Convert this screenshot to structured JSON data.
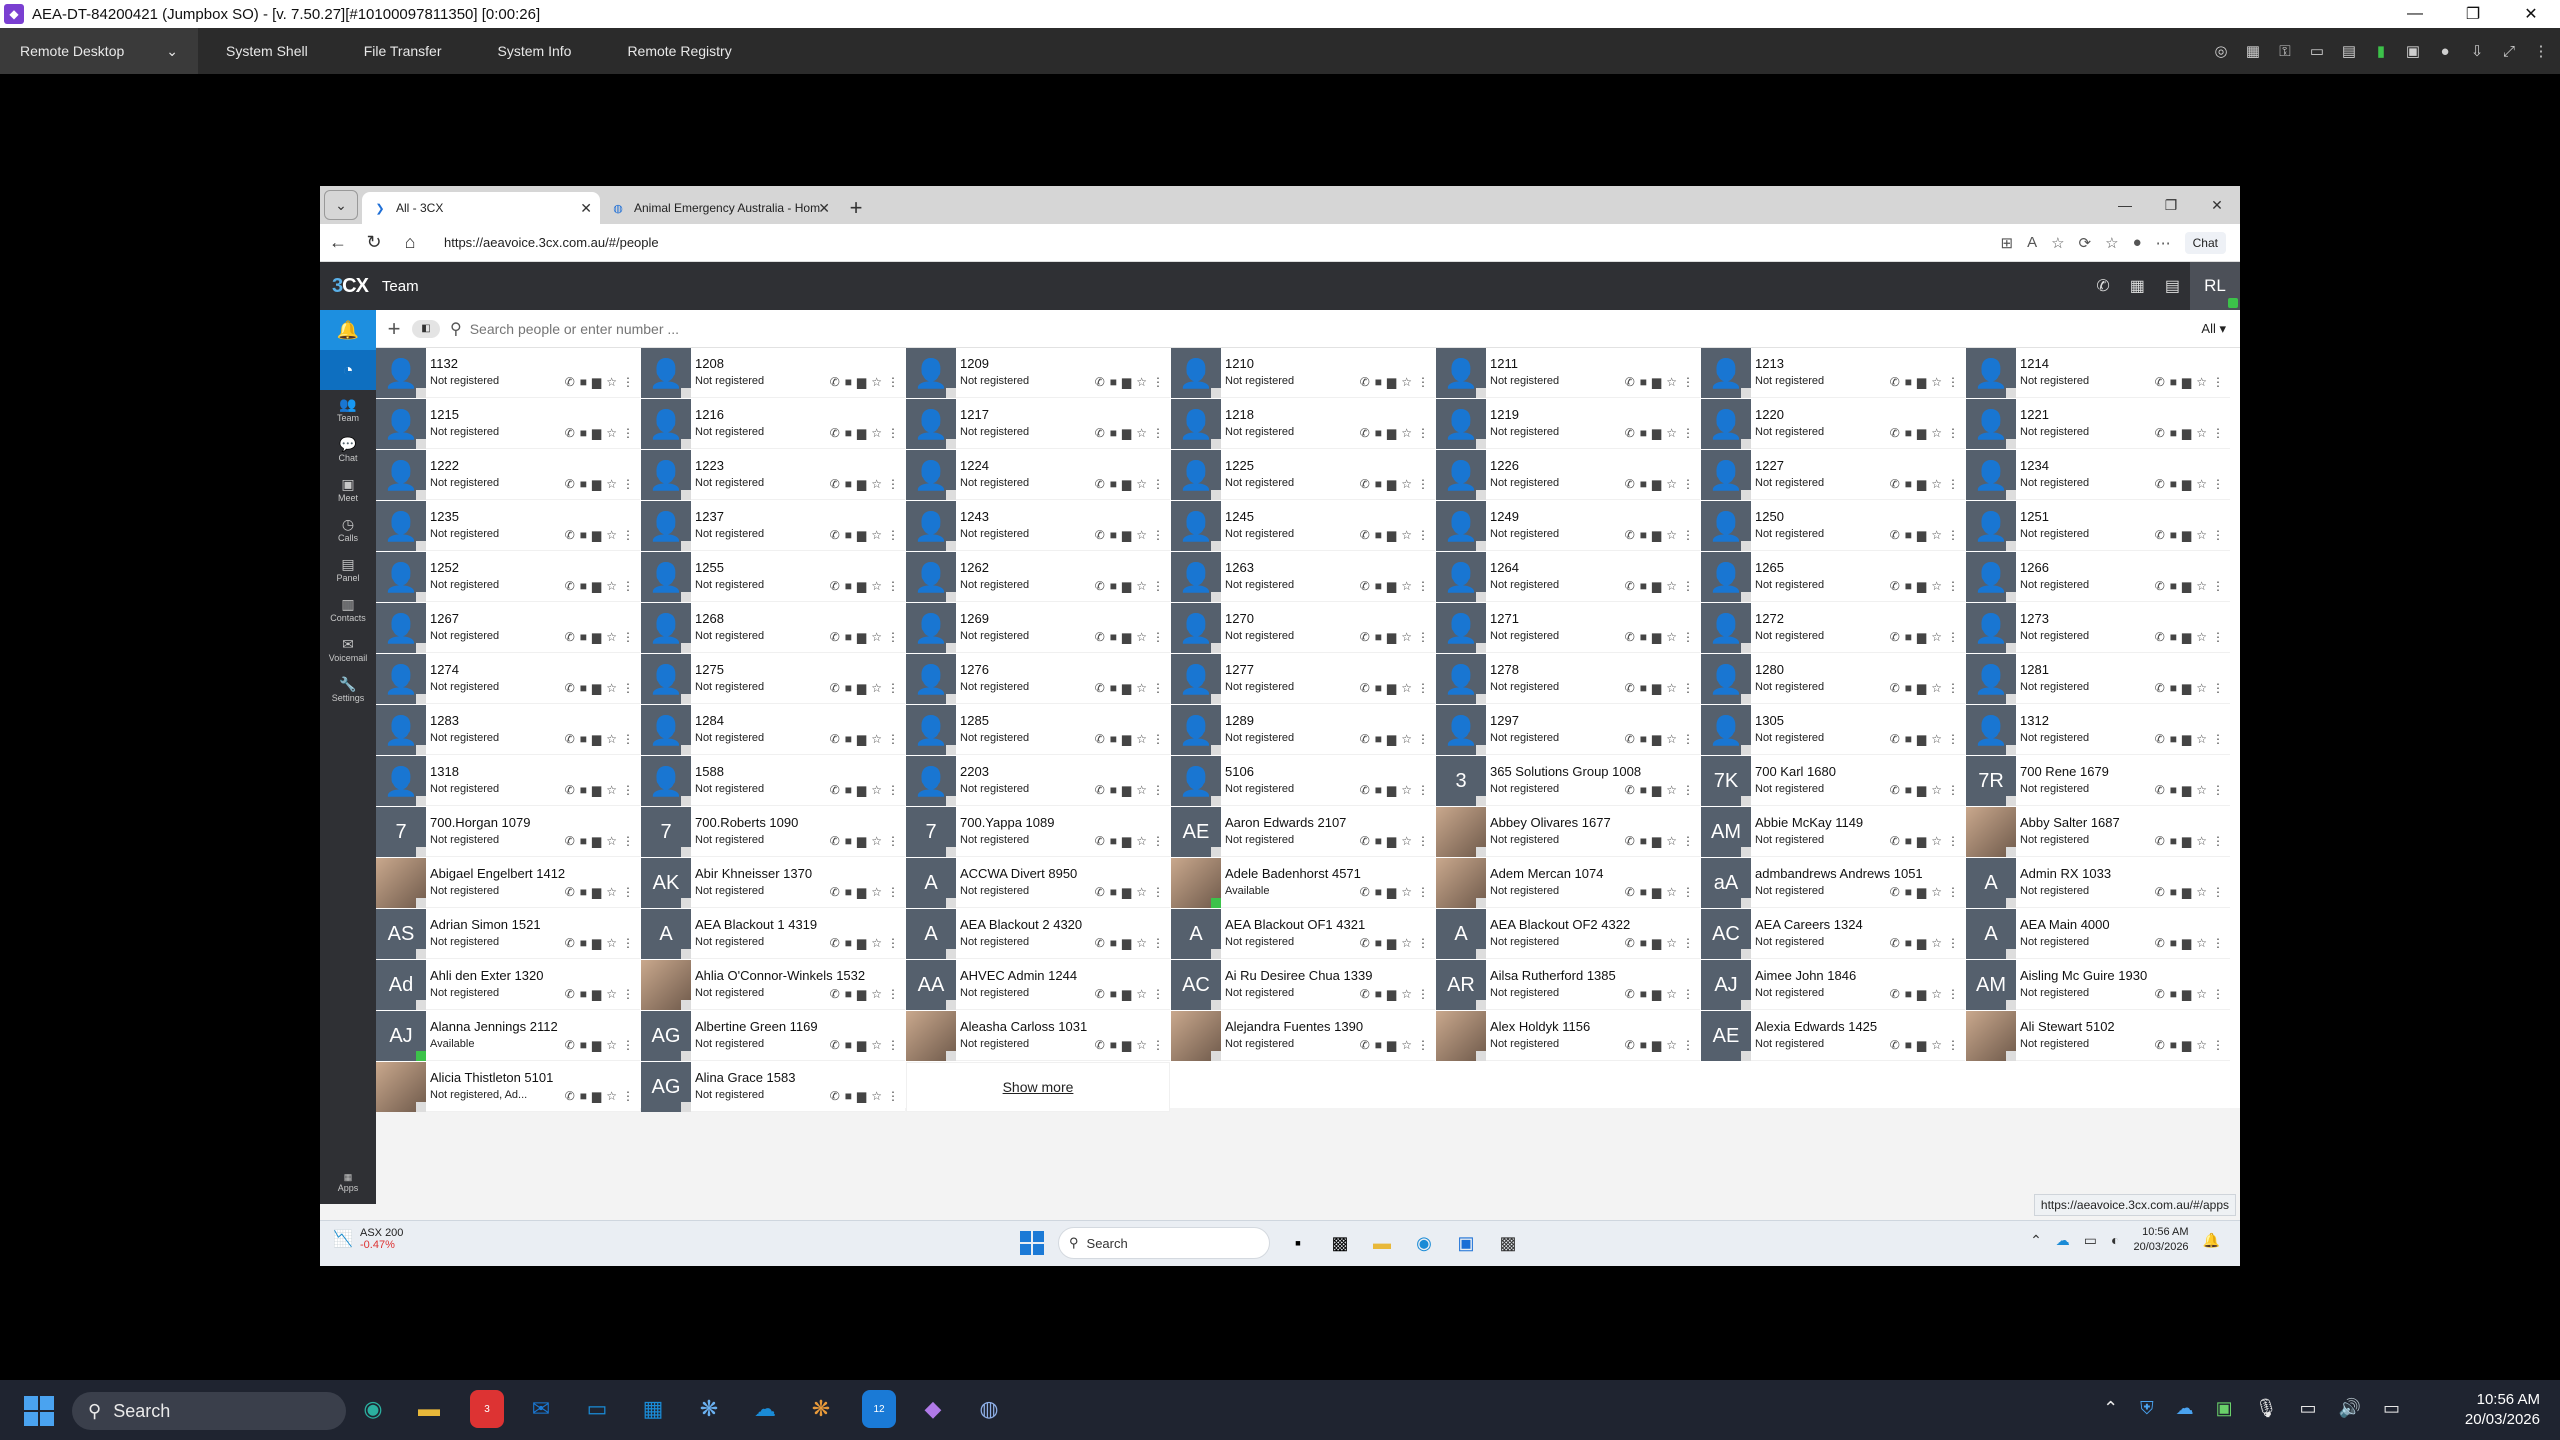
{
  "remote_window": {
    "title": "AEA-DT-84200421 (Jumpbox SO) -  [v. 7.50.27][#10100097811350] [0:00:26]",
    "menu": {
      "mode": "Remote Desktop",
      "items": [
        "System Shell",
        "File Transfer",
        "System Info",
        "Remote Registry"
      ]
    }
  },
  "browser": {
    "tabs": [
      {
        "label": "All - 3CX"
      },
      {
        "label": "Animal Emergency Australia - Hom"
      }
    ],
    "url": "https://aeavoice.3cx.com.au/#/people",
    "chat_button": "Chat"
  },
  "app": {
    "logo_prefix": "3",
    "logo_suffix": "CX",
    "title": "Team",
    "user_initials": "RL",
    "sidebar": [
      {
        "label": "Team",
        "icon": "team-icon"
      },
      {
        "label": "Chat",
        "icon": "chat-icon"
      },
      {
        "label": "Meet",
        "icon": "meet-icon"
      },
      {
        "label": "Calls",
        "icon": "calls-icon"
      },
      {
        "label": "Panel",
        "icon": "panel-icon"
      },
      {
        "label": "Contacts",
        "icon": "contacts-icon"
      },
      {
        "label": "Voicemail",
        "icon": "voicemail-icon"
      },
      {
        "label": "Settings",
        "icon": "settings-icon"
      }
    ],
    "apps_label": "Apps",
    "search_placeholder": "Search people or enter number ...",
    "filter": "All",
    "show_more": "Show more",
    "contacts": [
      {
        "name": "1132",
        "status": "Not registered",
        "avatar": "person"
      },
      {
        "name": "1208",
        "status": "Not registered",
        "avatar": "person"
      },
      {
        "name": "1209",
        "status": "Not registered",
        "avatar": "person"
      },
      {
        "name": "1210",
        "status": "Not registered",
        "avatar": "person"
      },
      {
        "name": "1211",
        "status": "Not registered",
        "avatar": "person"
      },
      {
        "name": "1213",
        "status": "Not registered",
        "avatar": "person"
      },
      {
        "name": "1214",
        "status": "Not registered",
        "avatar": "person"
      },
      {
        "name": "1215",
        "status": "Not registered",
        "avatar": "person"
      },
      {
        "name": "1216",
        "status": "Not registered",
        "avatar": "person"
      },
      {
        "name": "1217",
        "status": "Not registered",
        "avatar": "person"
      },
      {
        "name": "1218",
        "status": "Not registered",
        "avatar": "person"
      },
      {
        "name": "1219",
        "status": "Not registered",
        "avatar": "person"
      },
      {
        "name": "1220",
        "status": "Not registered",
        "avatar": "person"
      },
      {
        "name": "1221",
        "status": "Not registered",
        "avatar": "person"
      },
      {
        "name": "1222",
        "status": "Not registered",
        "avatar": "person"
      },
      {
        "name": "1223",
        "status": "Not registered",
        "avatar": "person"
      },
      {
        "name": "1224",
        "status": "Not registered",
        "avatar": "person"
      },
      {
        "name": "1225",
        "status": "Not registered",
        "avatar": "person"
      },
      {
        "name": "1226",
        "status": "Not registered",
        "avatar": "person"
      },
      {
        "name": "1227",
        "status": "Not registered",
        "avatar": "person"
      },
      {
        "name": "1234",
        "status": "Not registered",
        "avatar": "person"
      },
      {
        "name": "1235",
        "status": "Not registered",
        "avatar": "person"
      },
      {
        "name": "1237",
        "status": "Not registered",
        "avatar": "person"
      },
      {
        "name": "1243",
        "status": "Not registered",
        "avatar": "person"
      },
      {
        "name": "1245",
        "status": "Not registered",
        "avatar": "person"
      },
      {
        "name": "1249",
        "status": "Not registered",
        "avatar": "person"
      },
      {
        "name": "1250",
        "status": "Not registered",
        "avatar": "person"
      },
      {
        "name": "1251",
        "status": "Not registered",
        "avatar": "person"
      },
      {
        "name": "1252",
        "status": "Not registered",
        "avatar": "person"
      },
      {
        "name": "1255",
        "status": "Not registered",
        "avatar": "person"
      },
      {
        "name": "1262",
        "status": "Not registered",
        "avatar": "person"
      },
      {
        "name": "1263",
        "status": "Not registered",
        "avatar": "person"
      },
      {
        "name": "1264",
        "status": "Not registered",
        "avatar": "person"
      },
      {
        "name": "1265",
        "status": "Not registered",
        "avatar": "person"
      },
      {
        "name": "1266",
        "status": "Not registered",
        "avatar": "person"
      },
      {
        "name": "1267",
        "status": "Not registered",
        "avatar": "person"
      },
      {
        "name": "1268",
        "status": "Not registered",
        "avatar": "person"
      },
      {
        "name": "1269",
        "status": "Not registered",
        "avatar": "person"
      },
      {
        "name": "1270",
        "status": "Not registered",
        "avatar": "person"
      },
      {
        "name": "1271",
        "status": "Not registered",
        "avatar": "person"
      },
      {
        "name": "1272",
        "status": "Not registered",
        "avatar": "person"
      },
      {
        "name": "1273",
        "status": "Not registered",
        "avatar": "person"
      },
      {
        "name": "1274",
        "status": "Not registered",
        "avatar": "person"
      },
      {
        "name": "1275",
        "status": "Not registered",
        "avatar": "person"
      },
      {
        "name": "1276",
        "status": "Not registered",
        "avatar": "person"
      },
      {
        "name": "1277",
        "status": "Not registered",
        "avatar": "person"
      },
      {
        "name": "1278",
        "status": "Not registered",
        "avatar": "person"
      },
      {
        "name": "1280",
        "status": "Not registered",
        "avatar": "person"
      },
      {
        "name": "1281",
        "status": "Not registered",
        "avatar": "person"
      },
      {
        "name": "1283",
        "status": "Not registered",
        "avatar": "person"
      },
      {
        "name": "1284",
        "status": "Not registered",
        "avatar": "person"
      },
      {
        "name": "1285",
        "status": "Not registered",
        "avatar": "person"
      },
      {
        "name": "1289",
        "status": "Not registered",
        "avatar": "person"
      },
      {
        "name": "1297",
        "status": "Not registered",
        "avatar": "person"
      },
      {
        "name": "1305",
        "status": "Not registered",
        "avatar": "person"
      },
      {
        "name": "1312",
        "status": "Not registered",
        "avatar": "person"
      },
      {
        "name": "1318",
        "status": "Not registered",
        "avatar": "person"
      },
      {
        "name": "1588",
        "status": "Not registered",
        "avatar": "person"
      },
      {
        "name": "2203",
        "status": "Not registered",
        "avatar": "person"
      },
      {
        "name": "5106",
        "status": "Not registered",
        "avatar": "person"
      },
      {
        "name": "365 Solutions Group 1008",
        "status": "Not registered",
        "avatar": "3"
      },
      {
        "name": "700 Karl 1680",
        "status": "Not registered",
        "avatar": "7K"
      },
      {
        "name": "700 Rene 1679",
        "status": "Not registered",
        "avatar": "7R"
      },
      {
        "name": "700.Horgan 1079",
        "status": "Not registered",
        "avatar": "7"
      },
      {
        "name": "700.Roberts 1090",
        "status": "Not registered",
        "avatar": "7"
      },
      {
        "name": "700.Yappa 1089",
        "status": "Not registered",
        "avatar": "7"
      },
      {
        "name": "Aaron Edwards 2107",
        "status": "Not registered",
        "avatar": "AE"
      },
      {
        "name": "Abbey Olivares 1677",
        "status": "Not registered",
        "avatar": "photo"
      },
      {
        "name": "Abbie McKay 1149",
        "status": "Not registered",
        "avatar": "AM"
      },
      {
        "name": "Abby Salter 1687",
        "status": "Not registered",
        "avatar": "photo"
      },
      {
        "name": "Abigael Engelbert 1412",
        "status": "Not registered",
        "avatar": "photo"
      },
      {
        "name": "Abir Khneisser 1370",
        "status": "Not registered",
        "avatar": "AK"
      },
      {
        "name": "ACCWA Divert 8950",
        "status": "Not registered",
        "avatar": "A"
      },
      {
        "name": "Adele Badenhorst 4571",
        "status": "Available",
        "avatar": "photo",
        "online": true
      },
      {
        "name": "Adem Mercan 1074",
        "status": "Not registered",
        "avatar": "photo"
      },
      {
        "name": "admbandrews Andrews 1051",
        "status": "Not registered",
        "avatar": "aA"
      },
      {
        "name": "Admin RX 1033",
        "status": "Not registered",
        "avatar": "A"
      },
      {
        "name": "Adrian Simon 1521",
        "status": "Not registered",
        "avatar": "AS"
      },
      {
        "name": "AEA Blackout 1 4319",
        "status": "Not registered",
        "avatar": "A"
      },
      {
        "name": "AEA Blackout 2 4320",
        "status": "Not registered",
        "avatar": "A"
      },
      {
        "name": "AEA Blackout OF1 4321",
        "status": "Not registered",
        "avatar": "A"
      },
      {
        "name": "AEA Blackout OF2 4322",
        "status": "Not registered",
        "avatar": "A"
      },
      {
        "name": "AEA Careers 1324",
        "status": "Not registered",
        "avatar": "AC"
      },
      {
        "name": "AEA Main 4000",
        "status": "Not registered",
        "avatar": "A"
      },
      {
        "name": "Ahli den Exter 1320",
        "status": "Not registered",
        "avatar": "Ad"
      },
      {
        "name": "Ahlia O'Connor-Winkels 1532",
        "status": "Not registered",
        "avatar": "photo"
      },
      {
        "name": "AHVEC Admin 1244",
        "status": "Not registered",
        "avatar": "AA"
      },
      {
        "name": "Ai Ru Desiree Chua 1339",
        "status": "Not registered",
        "avatar": "AC"
      },
      {
        "name": "Ailsa Rutherford 1385",
        "status": "Not registered",
        "avatar": "AR"
      },
      {
        "name": "Aimee John 1846",
        "status": "Not registered",
        "avatar": "AJ"
      },
      {
        "name": "Aisling Mc Guire 1930",
        "status": "Not registered",
        "avatar": "AM"
      },
      {
        "name": "Alanna Jennings 2112",
        "status": "Available",
        "avatar": "AJ",
        "online": true
      },
      {
        "name": "Albertine Green 1169",
        "status": "Not registered",
        "avatar": "AG"
      },
      {
        "name": "Aleasha Carloss 1031",
        "status": "Not registered",
        "avatar": "photo"
      },
      {
        "name": "Alejandra Fuentes 1390",
        "status": "Not registered",
        "avatar": "photo"
      },
      {
        "name": "Alex Holdyk 1156",
        "status": "Not registered",
        "avatar": "photo"
      },
      {
        "name": "Alexia Edwards 1425",
        "status": "Not registered",
        "avatar": "AE"
      },
      {
        "name": "Ali Stewart 5102",
        "status": "Not registered",
        "avatar": "photo"
      },
      {
        "name": "Alicia Thistleton 5101",
        "status": "Not registered, Ad...",
        "avatar": "photo"
      },
      {
        "name": "Alina Grace 1583",
        "status": "Not registered",
        "avatar": "AG"
      }
    ],
    "status_url": "https://aeavoice.3cx.com.au/#/apps"
  },
  "remote_taskbar": {
    "ticker_name": "ASX 200",
    "ticker_change": "-0.47%",
    "search": "Search",
    "time": "10:56 AM",
    "date": "20/03/2026"
  },
  "local_taskbar": {
    "search": "Search",
    "teams_badge": "3",
    "threecx_badge": "12",
    "time": "10:56 AM",
    "date": "20/03/2026"
  }
}
